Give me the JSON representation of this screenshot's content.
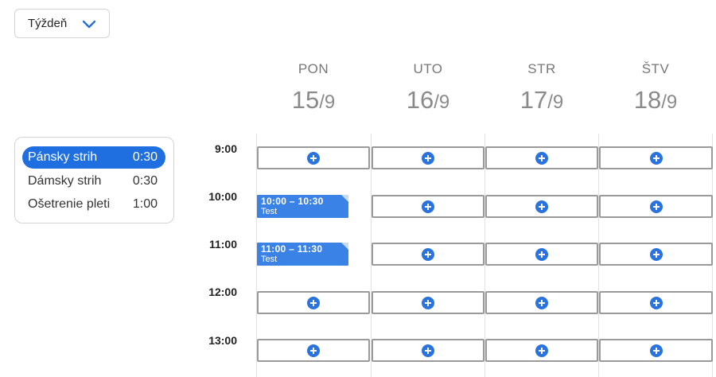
{
  "view_select": {
    "label": "Týždeň",
    "icon": "chevron-down-icon"
  },
  "services": [
    {
      "name": "Pánsky strih",
      "duration": "0:30",
      "active": true
    },
    {
      "name": "Dámsky strih",
      "duration": "0:30",
      "active": false
    },
    {
      "name": "Ošetrenie pleti",
      "duration": "1:00",
      "active": false
    }
  ],
  "days": [
    {
      "name": "PON",
      "day": "15",
      "month": "/9"
    },
    {
      "name": "UTO",
      "day": "16",
      "month": "/9"
    },
    {
      "name": "STR",
      "day": "17",
      "month": "/9"
    },
    {
      "name": "ŠTV",
      "day": "18",
      "month": "/9"
    }
  ],
  "times": [
    "9:00",
    "10:00",
    "11:00",
    "12:00",
    "13:00"
  ],
  "events": [
    {
      "day": 0,
      "hour": 1,
      "time": "10:00 – 10:30",
      "title": "Test"
    },
    {
      "day": 0,
      "hour": 2,
      "time": "11:00 – 11:30",
      "title": "Test"
    }
  ],
  "colors": {
    "accent": "#1f6fe0",
    "event": "#3b82e6",
    "add_icon": "#2a73de"
  },
  "add_slot_icon": "plus-circle-icon"
}
